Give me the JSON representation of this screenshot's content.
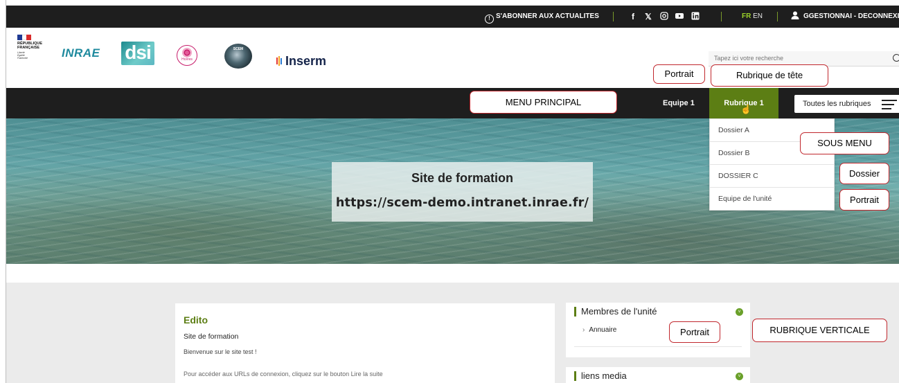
{
  "topbar": {
    "subscribe": "S'ABONNER AUX ACTUALITES",
    "social_icons": [
      "facebook-icon",
      "x-icon",
      "instagram-icon",
      "youtube-icon",
      "linkedin-icon"
    ],
    "lang_fr": "FR",
    "lang_en": "EN",
    "user": "GGESTIONNAI - DECONNEXIO"
  },
  "logos": {
    "republique": "RÉPUBLIQUE FRANÇAISE",
    "republique_motto": "Liberté Égalité Fraternité",
    "inrae": "INRAE",
    "dsi": "dsi",
    "hceres": "Hcéres",
    "scem": "SCEM",
    "inserm": "Inserm"
  },
  "search": {
    "placeholder": "Tapez ici votre recherche"
  },
  "nav": {
    "equipe": "Equipe 1",
    "rubrique": "Rubrique 1",
    "all": "Toutes les rubriques"
  },
  "dropdown": [
    "Dossier A",
    "Dossier B",
    "DOSSIER C",
    "Equipe de l'unité"
  ],
  "hero": {
    "title": "Site de formation",
    "url": "https://scem-demo.intranet.inrae.fr/"
  },
  "edito": {
    "title": "Edito",
    "subtitle": "Site de formation",
    "p1": "Bienvenue sur le site test !",
    "p2": "Pour accéder aux URLs de connexion, cliquez sur le bouton Lire la suite"
  },
  "side": {
    "membres_title": "Membres de l'unité",
    "annuaire": "Annuaire",
    "liens_title": "liens media"
  },
  "callouts": {
    "portrait_nav": "Portrait",
    "rubrique_tete": "Rubrique de tête",
    "menu_principal": "MENU PRINCIPAL",
    "sous_menu": "SOUS MENU",
    "dossier": "Dossier",
    "portrait_dd": "Portrait",
    "portrait_side": "Portrait",
    "rubrique_verticale": "RUBRIQUE VERTICALE"
  },
  "colors": {
    "accent_green": "#5c7e14",
    "dark_bar": "#1e1e1e",
    "callout_border": "#c0262c"
  }
}
